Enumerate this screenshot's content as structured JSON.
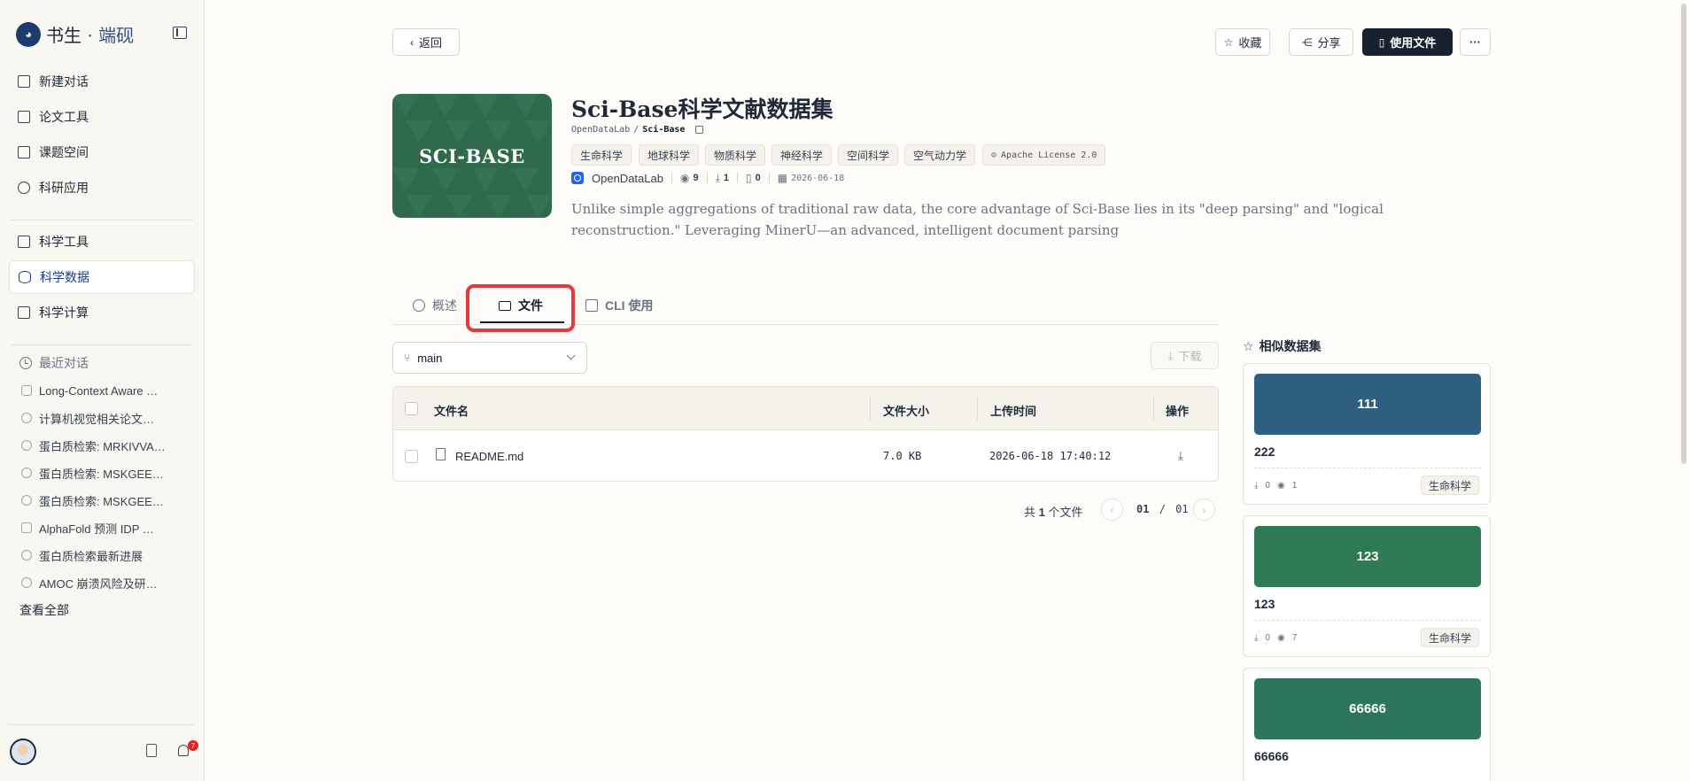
{
  "sidebar": {
    "logo": {
      "part1": "书生",
      "dot": "·",
      "part2": "端砚"
    },
    "nav": [
      {
        "label": "新建对话",
        "icon": "plus-square-icon"
      },
      {
        "label": "论文工具",
        "icon": "document-icon"
      },
      {
        "label": "课题空间",
        "icon": "books-icon"
      },
      {
        "label": "科研应用",
        "icon": "hexagon-icon"
      },
      {
        "label": "科学工具",
        "icon": "toolbox-icon"
      },
      {
        "label": "科学数据",
        "icon": "database-icon",
        "active": true
      },
      {
        "label": "科学计算",
        "icon": "monitor-icon"
      }
    ],
    "recent_title": "最近对话",
    "recent": [
      "Long-Context Aware …",
      "计算机视觉相关论文…",
      "蛋白质检索: MRKIVVA…",
      "蛋白质检索: MSKGEE…",
      "蛋白质检索: MSKGEE…",
      "AlphaFold 预测 IDP …",
      "蛋白质检索最新进展",
      "AMOC 崩溃风险及研…"
    ],
    "view_all": "查看全部",
    "notification_count": "7"
  },
  "topbar": {
    "back": "返回",
    "favorite": "收藏",
    "share": "分享",
    "use_file": "使用文件",
    "more": "···"
  },
  "dataset": {
    "cover_text": "SCI-BASE",
    "title": "Sci-Base科学文献数据集",
    "owner": "OpenDataLab",
    "repo": "Sci-Base",
    "tags": [
      "生命科学",
      "地球科学",
      "物质科学",
      "神经科学",
      "空间科学",
      "空气动力学"
    ],
    "license": "Apache License 2.0",
    "org": "OpenDataLab",
    "views": "9",
    "downloads": "1",
    "files": "0",
    "date": "2026-06-18",
    "description": "Unlike simple aggregations of traditional raw data, the core advantage of Sci-Base lies in its \"deep parsing\" and \"logical reconstruction.\" Leveraging MinerU—an advanced, intelligent document parsing"
  },
  "tabs": [
    {
      "label": "概述"
    },
    {
      "label": "文件",
      "active": true
    },
    {
      "label": "CLI 使用"
    }
  ],
  "files": {
    "branch": "main",
    "download": "下载",
    "columns": [
      "文件名",
      "文件大小",
      "上传时间",
      "操作"
    ],
    "rows": [
      {
        "name": "README.md",
        "size": "7.0 KB",
        "time": "2026-06-18 17:40:12"
      }
    ],
    "total_prefix": "共",
    "total_count": "1",
    "total_suffix": "个文件",
    "page_current": "01",
    "page_sep": "/",
    "page_total": "01"
  },
  "similar": {
    "title": "相似数据集",
    "cards": [
      {
        "cover": "111",
        "name": "222",
        "downloads": "0",
        "views": "1",
        "tag": "生命科学",
        "color": "#2e5f80"
      },
      {
        "cover": "123",
        "name": "123",
        "downloads": "0",
        "views": "7",
        "tag": "生命科学",
        "color": "#2f7a52"
      },
      {
        "cover": "66666",
        "name": "66666",
        "color": "#2e7560"
      }
    ]
  }
}
